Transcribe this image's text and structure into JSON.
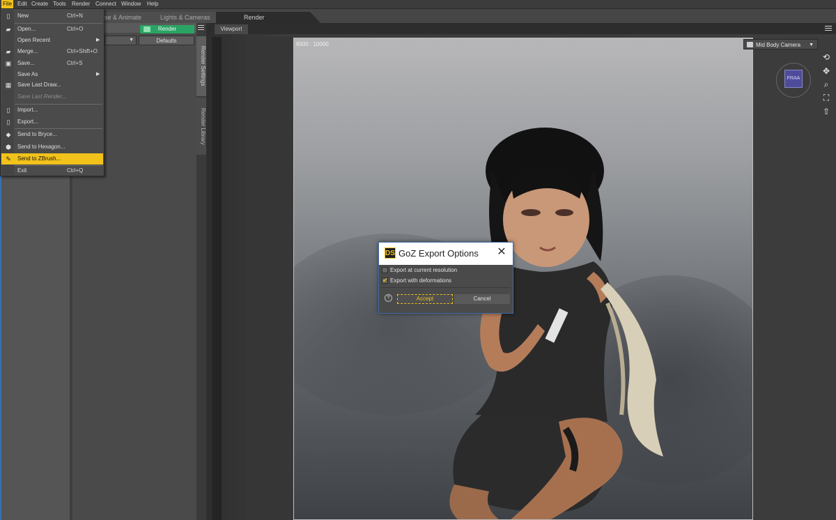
{
  "menubar": {
    "items": [
      "File",
      "Edit",
      "Create",
      "Tools",
      "Render",
      "Connect",
      "Window",
      "Help"
    ]
  },
  "tabs": [
    "se & Animate",
    "Lights & Cameras",
    "Render"
  ],
  "render_panel": {
    "render_label": "Render",
    "defaults_label": "Defaults",
    "side_tabs": [
      "Render Settings",
      "Render Library"
    ]
  },
  "file_menu": {
    "items": [
      {
        "label": "New",
        "shortcut": "Ctrl+N",
        "icon": "new-doc-icon"
      },
      {
        "label": "Open...",
        "shortcut": "Ctrl+O",
        "icon": "folder-icon"
      },
      {
        "label": "Open Recent",
        "shortcut": "",
        "icon": "",
        "submenu": true
      },
      {
        "label": "Merge...",
        "shortcut": "Ctrl+Shift+O",
        "icon": "merge-icon"
      },
      {
        "label": "Save...",
        "shortcut": "Ctrl+S",
        "icon": "floppy-icon"
      },
      {
        "label": "Save As",
        "shortcut": "",
        "icon": "",
        "submenu": true
      },
      {
        "label": "Save Last Draw...",
        "shortcut": "",
        "icon": "image-icon"
      },
      {
        "label": "Save Last Render...",
        "shortcut": "",
        "icon": "",
        "disabled": true
      },
      {
        "label": "Import...",
        "shortcut": "",
        "icon": "import-icon"
      },
      {
        "label": "Export...",
        "shortcut": "",
        "icon": "export-icon"
      },
      {
        "label": "Send to Bryce...",
        "shortcut": "",
        "icon": "bryce-icon"
      },
      {
        "label": "Send to Hexagon...",
        "shortcut": "",
        "icon": "hexagon-icon"
      },
      {
        "label": "Send to ZBrush...",
        "shortcut": "",
        "icon": "zbrush-icon",
        "highlighted": true
      },
      {
        "label": "Exit",
        "shortcut": "Ctrl+Q",
        "icon": ""
      }
    ]
  },
  "viewport": {
    "tab_label": "Viewport",
    "resolution": "6500 : 10000",
    "camera": "Mid Body Camera",
    "navcube_face": "FRAA"
  },
  "dialog": {
    "title": "GoZ Export Options",
    "logo": "DS",
    "options": [
      {
        "label": "Export at current resolution",
        "checked": false
      },
      {
        "label": "Export with deformations",
        "checked": true
      }
    ],
    "accept_label": "Accept",
    "cancel_label": "Cancel",
    "help_glyph": "?"
  },
  "colors": {
    "accent": "#f2c21b",
    "render_button": "#2aa464",
    "dialog_border": "#3f6aa8"
  }
}
